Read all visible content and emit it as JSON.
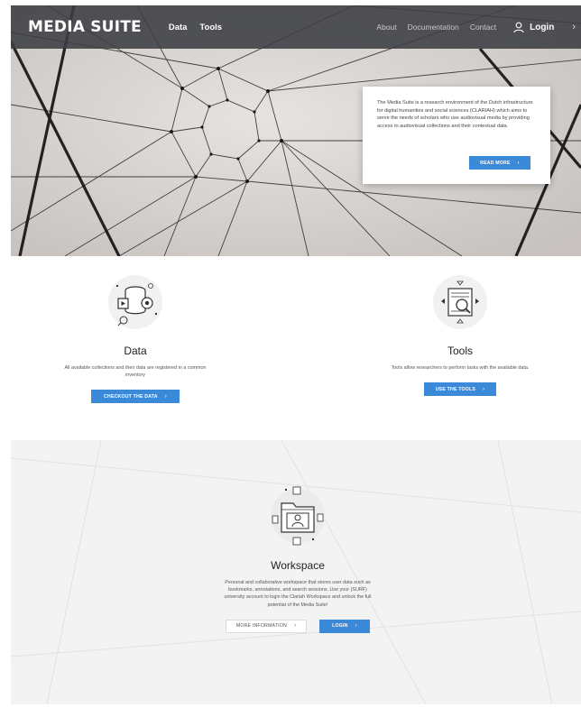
{
  "navbar": {
    "brand": "MEDIA SUITE",
    "links": [
      "Data",
      "Tools"
    ],
    "secondary_links": [
      "About",
      "Documentation",
      "Contact"
    ],
    "login_label": "Login",
    "arrow": "›"
  },
  "hero": {
    "description": "The Media Suite is a research environment of the Dutch infrastructure for digital humanities and social sciences (CLARIAH) which aims to serve the needs of scholars who use audiovisual media by providing access to audiovisual collections and their contextual data.",
    "read_more_label": "READ MORE",
    "chevron": "›"
  },
  "data_section": {
    "title": "Data",
    "description": "All available collections and their data are registered in a common inventory",
    "button_label": "CHECKOUT THE DATA",
    "chevron": "›",
    "icon": "database-icon"
  },
  "tools_section": {
    "title": "Tools",
    "description": "Tools allow researchers to perform tasks with the available data.",
    "button_label": "USE THE TOOLS",
    "chevron": "›",
    "icon": "magnifier-document-icon"
  },
  "workspace_section": {
    "title": "Workspace",
    "description": "Personal and collaborative workspace that stores user data such as bookmarks, annotations, and search sessions. Use your (SURF) university account to login the Clariah Workspace and unlock the full potential of the Media Suite!",
    "more_info_label": "MORE INFORMATION",
    "login_label": "LOGIN",
    "chevron": "›",
    "icon": "workspace-folder-icon"
  },
  "colors": {
    "accent": "#3b8ad9",
    "navbar": "#3c3e42",
    "workspace_bg": "#f3f3f3"
  }
}
